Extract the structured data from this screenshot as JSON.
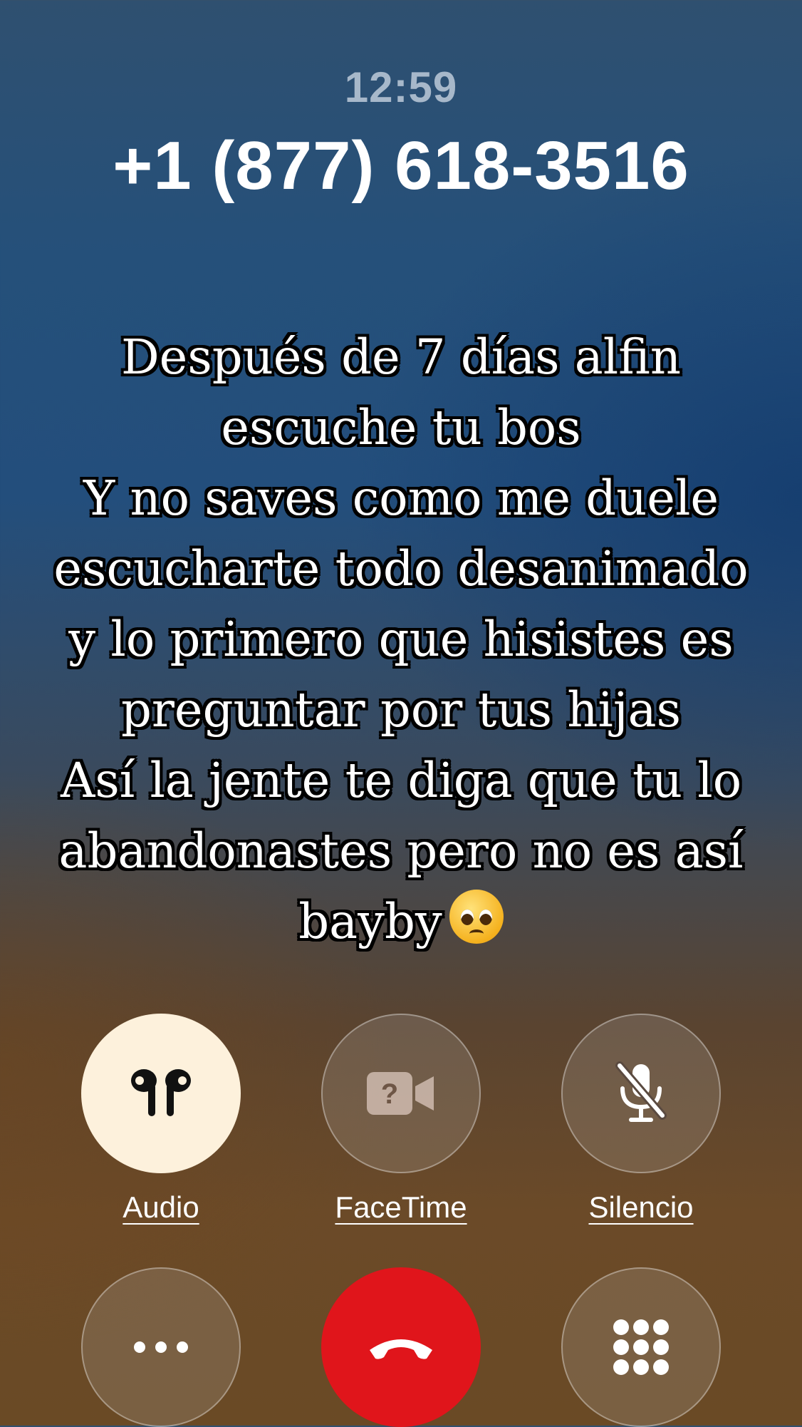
{
  "call": {
    "time": "12:59",
    "number": "+1 (877) 618-3516"
  },
  "caption": {
    "text": "Después de 7 días alfin\nescuche tu bos\nY no saves como me duele\nescucharte todo desanimado\ny lo primero que hisistes es\npreguntar por tus hijas\nAsí la jente te diga que tu lo\nabandonastes pero no es así\nbayby",
    "emoji": "pleading-face-with-tears-emoji"
  },
  "controls": {
    "audio": {
      "label": "Audio",
      "icon": "airpods-icon",
      "bg": "#fdf1dc"
    },
    "facetime": {
      "label": "FaceTime",
      "icon": "video-camera-question-icon"
    },
    "mute": {
      "label": "Silencio",
      "icon": "microphone-slash-icon"
    },
    "more": {
      "icon": "ellipsis-icon"
    },
    "end_call": {
      "icon": "phone-hangup-icon",
      "color": "#e0151b"
    },
    "keypad": {
      "icon": "keypad-icon"
    }
  }
}
